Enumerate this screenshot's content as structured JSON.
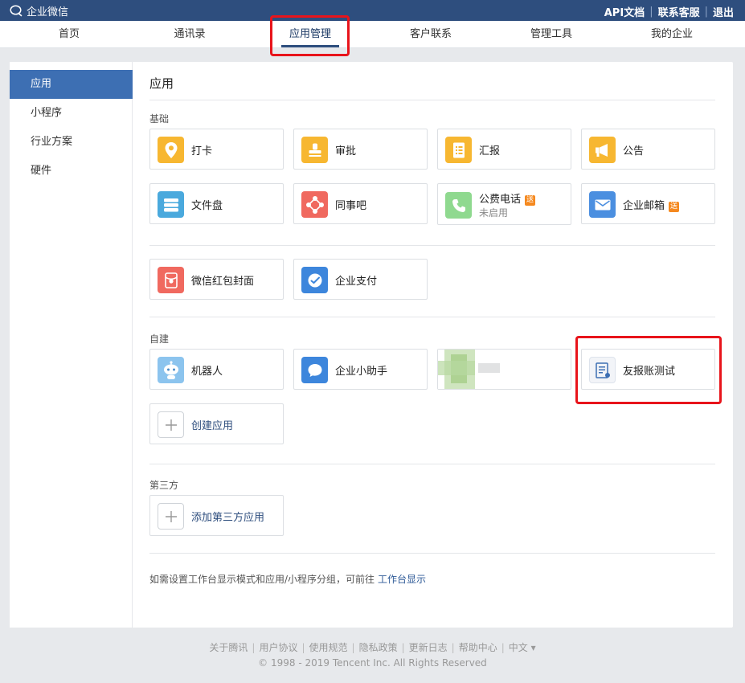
{
  "topbar": {
    "brand": "企业微信",
    "links": [
      "API文档",
      "联系客服",
      "退出"
    ]
  },
  "nav": {
    "items": [
      "首页",
      "通讯录",
      "应用管理",
      "客户联系",
      "管理工具",
      "我的企业"
    ],
    "active": "应用管理"
  },
  "sidebar": {
    "items": [
      "应用",
      "小程序",
      "行业方案",
      "硬件"
    ],
    "active": "应用"
  },
  "main": {
    "title": "应用",
    "sections": {
      "basic": "基础",
      "custom": "自建",
      "third_party": "第三方"
    },
    "basic_apps": [
      {
        "name": "打卡",
        "icon": "location-pin-icon",
        "color": "#f7b731"
      },
      {
        "name": "审批",
        "icon": "stamp-icon",
        "color": "#f7b731"
      },
      {
        "name": "汇报",
        "icon": "report-document-icon",
        "color": "#f7b731"
      },
      {
        "name": "公告",
        "icon": "megaphone-icon",
        "color": "#f7b731"
      },
      {
        "name": "文件盘",
        "icon": "disk-stack-icon",
        "color": "#4aa9dd"
      },
      {
        "name": "同事吧",
        "icon": "share-nodes-icon",
        "color": "#f0695f"
      },
      {
        "name": "公费电话",
        "status": "未启用",
        "badge": "送",
        "icon": "phone-icon",
        "color": "#8fd98f"
      },
      {
        "name": "企业邮箱",
        "badge": "送",
        "icon": "mail-icon",
        "color": "#4b8fe0"
      }
    ],
    "extra_apps": [
      {
        "name": "微信红包封面",
        "icon": "red-envelope-icon",
        "color": "#f0695f"
      },
      {
        "name": "企业支付",
        "icon": "payment-check-icon",
        "color": "#3d86dc"
      }
    ],
    "custom_apps": [
      {
        "name": "机器人",
        "icon": "robot-icon",
        "color": "#8cc4ee"
      },
      {
        "name": "企业小助手",
        "icon": "chat-bubble-icon",
        "color": "#3d86dc"
      },
      {
        "name": "",
        "icon": "blurred-app-icon",
        "color": "#a8cf8b"
      },
      {
        "name": "友报账测试",
        "icon": "expense-form-icon",
        "color": "#f2f4f8"
      }
    ],
    "create_app": "创建应用",
    "add_third_party": "添加第三方应用",
    "tip_text": "如需设置工作台显示模式和应用/小程序分组，可前往",
    "tip_link": "工作台显示"
  },
  "footer": {
    "links": [
      "关于腾讯",
      "用户协议",
      "使用规范",
      "隐私政策",
      "更新日志",
      "帮助中心",
      "中文 ▾"
    ],
    "copyright": "© 1998 - 2019 Tencent Inc. All Rights Reserved"
  },
  "colors": {
    "topbar": "#2e4e7e",
    "sidebar_active": "#3d6fb3",
    "highlight": "#e8141b",
    "badge": "#f5891f"
  }
}
